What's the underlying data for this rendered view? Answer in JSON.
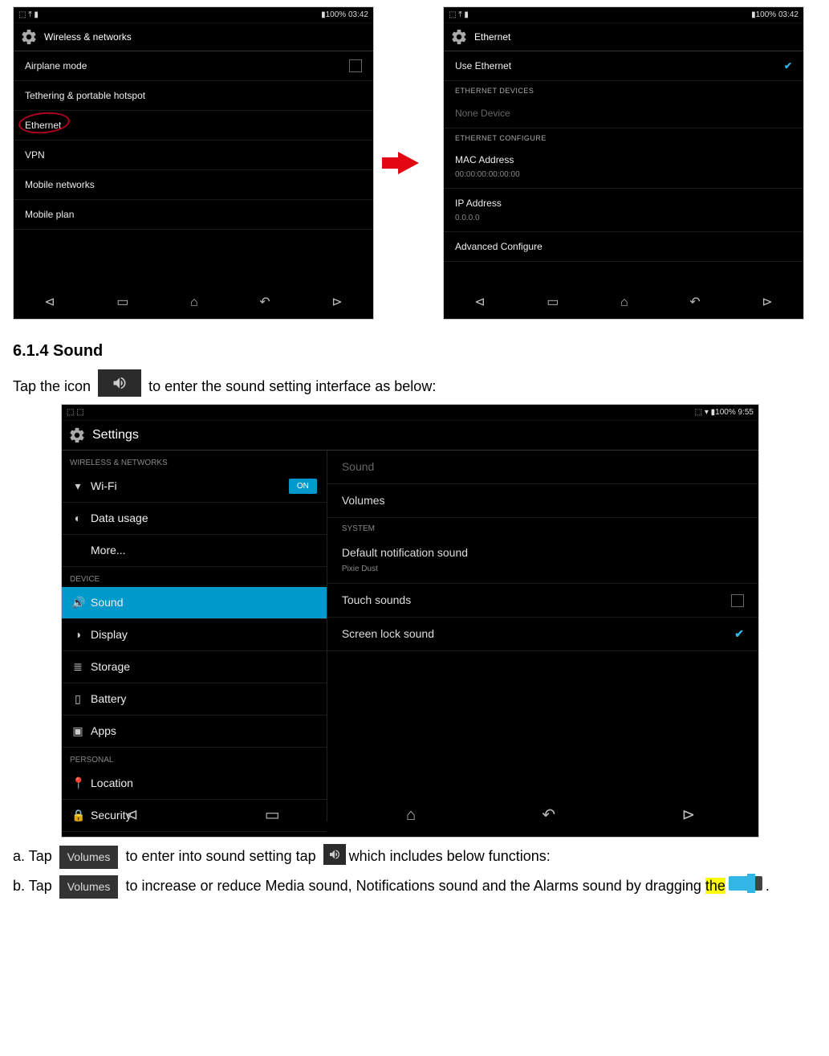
{
  "screenshots": {
    "wireless": {
      "status_left": "⬚ ⤒ ▮",
      "status_right": "▮100% 03:42",
      "title": "Wireless & networks",
      "items": [
        {
          "label": "Airplane mode"
        },
        {
          "label": "Tethering & portable hotspot"
        },
        {
          "label": "Ethernet",
          "circled": true
        },
        {
          "label": "VPN"
        },
        {
          "label": "Mobile networks"
        },
        {
          "label": "Mobile plan"
        }
      ]
    },
    "ethernet": {
      "status_left": "⬚ ⤒ ▮",
      "status_right": "▮100% 03:42",
      "title": "Ethernet",
      "use_ethernet": "Use Ethernet",
      "section_devices": "ETHERNET DEVICES",
      "none_device": "None Device",
      "section_configure": "ETHERNET CONFIGURE",
      "mac_label": "MAC Address",
      "mac_value": "00:00:00:00:00:00",
      "ip_label": "IP Address",
      "ip_value": "0.0.0.0",
      "advanced": "Advanced Configure"
    },
    "settings": {
      "status_left": "⬚ ⬚",
      "status_right": "⬚ ▾  ▮100% 9:55",
      "title": "Settings",
      "side_sections": {
        "wireless": "WIRELESS & NETWORKS",
        "device": "DEVICE",
        "personal": "PERSONAL"
      },
      "side_items": {
        "wifi": "Wi-Fi",
        "wifi_toggle": "ON",
        "data": "Data usage",
        "more": "More...",
        "sound": "Sound",
        "display": "Display",
        "storage": "Storage",
        "battery": "Battery",
        "apps": "Apps",
        "location": "Location",
        "security": "Security"
      },
      "main_header": "Sound",
      "main_items": {
        "volumes": "Volumes",
        "system_section": "SYSTEM",
        "notif": "Default notification sound",
        "notif_sub": "Pixie Dust",
        "touch": "Touch sounds",
        "lock": "Screen lock sound"
      }
    }
  },
  "doc": {
    "heading": "6.1.4 Sound",
    "p1_a": "Tap the icon ",
    "p1_b": " to enter the sound setting interface as below:",
    "p2_a": "a. Tap ",
    "p2_b": " to enter into sound setting tap ",
    "p2_c": "which includes below functions:",
    "p3_a": "b. Tap ",
    "p3_b": " to increase or reduce Media sound, Notifications sound and the Alarms sound by dragging ",
    "p3_c": "the",
    "p3_d": ".",
    "volumes_label": "Volumes"
  }
}
